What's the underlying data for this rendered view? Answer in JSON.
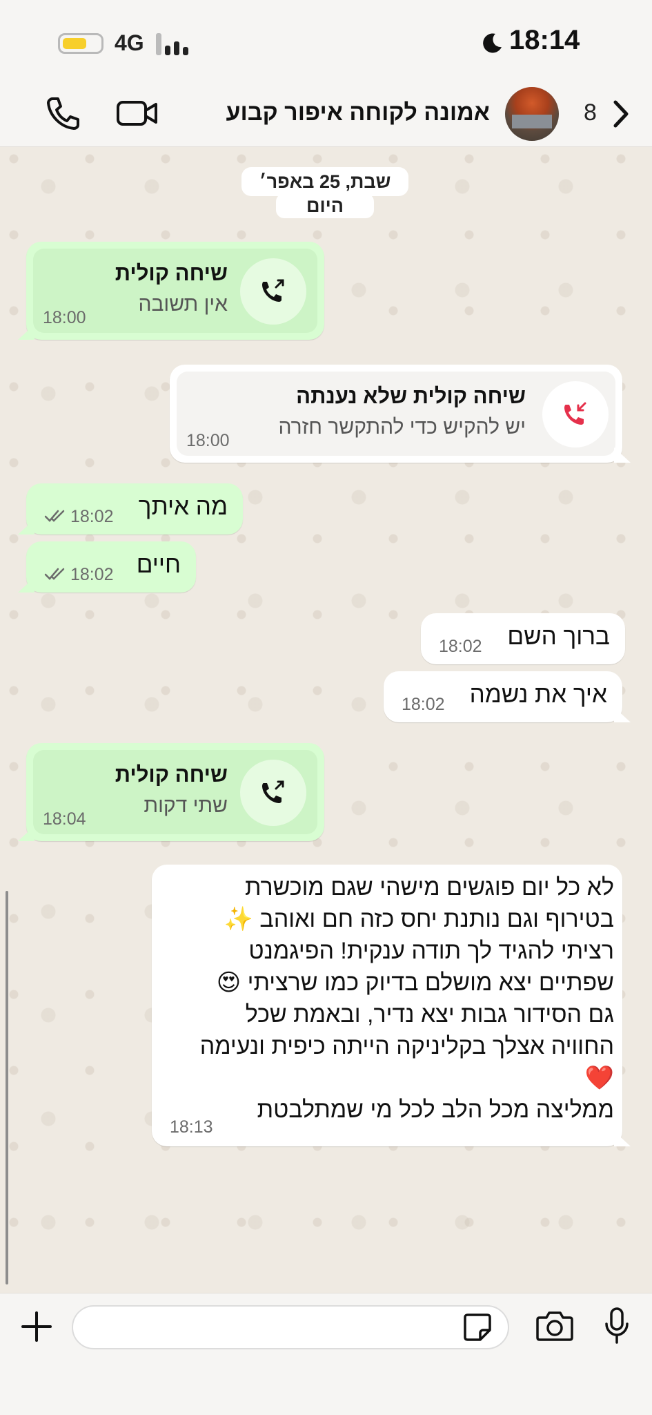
{
  "status_bar": {
    "network": "4G",
    "time": "18:14",
    "battery_level": 0.5,
    "battery_color": "#f7cf2b"
  },
  "header": {
    "unread_count": "8",
    "chat_title": "אמונה לקוחה איפור קבוע",
    "icons": [
      "chevron-left-icon",
      "avatar",
      "video-call-icon",
      "voice-call-icon"
    ]
  },
  "date_separator": {
    "date": "שבת, 25 באפר׳",
    "today": "היום"
  },
  "messages": [
    {
      "type": "call",
      "direction": "outgoing",
      "title": "שיחה קולית",
      "subtitle": "אין תשובה",
      "time": "18:00"
    },
    {
      "type": "call",
      "direction": "incoming-missed",
      "title": "שיחה קולית שלא נענתה",
      "subtitle": "יש להקיש כדי להתקשר חזרה",
      "time": "18:00"
    },
    {
      "type": "text",
      "direction": "outgoing",
      "text": "מה איתך",
      "time": "18:02",
      "read": true
    },
    {
      "type": "text",
      "direction": "outgoing",
      "text": "חיים",
      "time": "18:02",
      "read": true
    },
    {
      "type": "text",
      "direction": "incoming",
      "text": "ברוך השם",
      "time": "18:02"
    },
    {
      "type": "text",
      "direction": "incoming",
      "text": "איך את נשמה",
      "time": "18:02"
    },
    {
      "type": "call",
      "direction": "outgoing",
      "title": "שיחה קולית",
      "subtitle": "שתי דקות",
      "time": "18:04"
    },
    {
      "type": "text",
      "direction": "incoming",
      "time": "18:13",
      "lines": [
        "לא כל יום פוגשים מישהי שגם מוכשרת",
        "בטירוף וגם נותנת יחס כזה חם ואוהב ✨",
        "רציתי להגיד לך תודה ענקית! הפיגמנט",
        "שפתיים יצא מושלם בדיוק כמו שרציתי 😍",
        "גם הסידור גבות יצא נדיר, ובאמת שכל",
        "החוויה אצלך בקליניקה הייתה כיפית ונעימה",
        "❤️",
        "ממליצה מכל הלב לכל מי שמתלבטת"
      ]
    }
  ],
  "composer": {
    "placeholder": "",
    "icons": [
      "plus-icon",
      "sticker-icon",
      "camera-icon",
      "microphone-icon"
    ]
  },
  "colors": {
    "outgoing_bubble": "#d8fdd2",
    "incoming_bubble": "#ffffff",
    "missed_call_red": "#e5304b",
    "wallpaper": "#efeae2"
  }
}
